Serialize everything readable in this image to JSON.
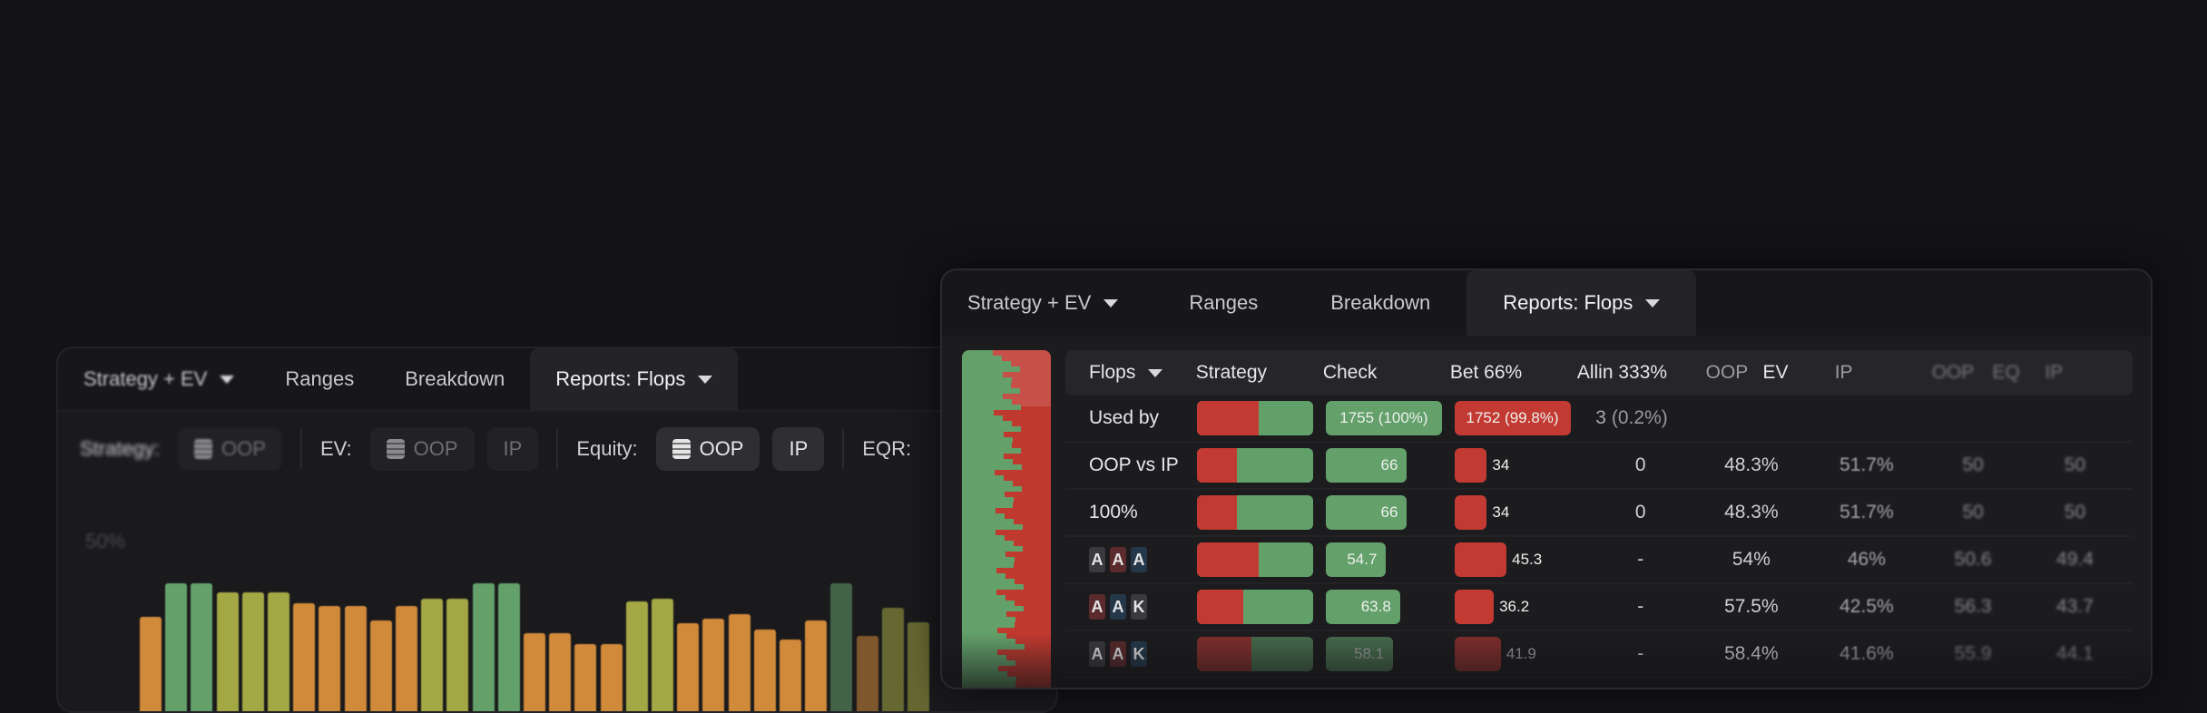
{
  "back_window": {
    "tabs": [
      {
        "label": "Strategy + EV",
        "active": false
      },
      {
        "label": "Ranges",
        "active": false
      },
      {
        "label": "Breakdown",
        "active": false
      },
      {
        "label": "Reports: Flops",
        "active": true
      }
    ],
    "toolbar": {
      "strategy_label": "Strategy:",
      "strategy_oop": "OOP",
      "ev_label": "EV:",
      "ev_oop": "OOP",
      "ev_ip": "IP",
      "equity_label": "Equity:",
      "equity_oop": "OOP",
      "equity_ip": "IP",
      "eqr_label": "EQR:"
    },
    "y_axis_label": "50%",
    "bar_heights": [
      0.66,
      0.88,
      0.88,
      0.82,
      0.82,
      0.82,
      0.75,
      0.73,
      0.73,
      0.64,
      0.73,
      0.78,
      0.78,
      0.88,
      0.88,
      0.56,
      0.56,
      0.49,
      0.49,
      0.76,
      0.78,
      0.62,
      0.65,
      0.68,
      0.58,
      0.52,
      0.64,
      0.88,
      0.54,
      0.72,
      0.63
    ],
    "bar_colors": [
      "#d08a3a",
      "#63a06a",
      "#63a06a",
      "#a4a844",
      "#a4a844",
      "#a4a844",
      "#d08a3a",
      "#d08a3a",
      "#d08a3a",
      "#d08a3a",
      "#d08a3a",
      "#a4a844",
      "#a4a844",
      "#63a06a",
      "#63a06a",
      "#d08a3a",
      "#d08a3a",
      "#d08a3a",
      "#d08a3a",
      "#a4a844",
      "#a4a844",
      "#d08a3a",
      "#d08a3a",
      "#d08a3a",
      "#d08a3a",
      "#d08a3a",
      "#d08a3a",
      "#63a06a",
      "#d08a3a",
      "#a4a844",
      "#a4a844"
    ]
  },
  "front_window": {
    "tabs": [
      {
        "label": "Strategy + EV",
        "active": false
      },
      {
        "label": "Ranges",
        "active": false
      },
      {
        "label": "Breakdown",
        "active": false
      },
      {
        "label": "Reports: Flops",
        "active": true
      }
    ],
    "headers": {
      "flops": "Flops",
      "strategy": "Strategy",
      "check": "Check",
      "bet": "Bet 66%",
      "allin": "Allin 333%",
      "oop": "OOP",
      "ev": "EV",
      "ip": "IP",
      "oop2": "OOP",
      "eq": "EQ",
      "ip2": "IP"
    },
    "rows": [
      {
        "label": "Used by",
        "strat_red": 0.53,
        "check": "1755 (100%)",
        "check_fill": 1.0,
        "bet": "1752 (99.8%)",
        "bet_fill": 1.0,
        "allin": "3",
        "allin_pct": "(0.2%)",
        "oop_ev": "",
        "ip_ev": "",
        "oop_eq": "",
        "ip_eq": ""
      },
      {
        "label": "OOP vs IP",
        "strat_red": 0.34,
        "check": "66",
        "check_fill": 0.7,
        "bet": "34",
        "bet_fill": 0.28,
        "allin": "0",
        "allin_pct": "",
        "oop_ev": "48.3%",
        "ip_ev": "51.7%",
        "oop_eq": "50",
        "ip_eq": "50"
      },
      {
        "label": "100%",
        "strat_red": 0.34,
        "check": "66",
        "check_fill": 0.7,
        "bet": "34",
        "bet_fill": 0.28,
        "allin": "0",
        "allin_pct": "",
        "oop_ev": "48.3%",
        "ip_ev": "51.7%",
        "oop_eq": "50",
        "ip_eq": "50"
      },
      {
        "label": "",
        "cards": [
          {
            "r": "A",
            "s": "g"
          },
          {
            "r": "A",
            "s": "r"
          },
          {
            "r": "A",
            "s": "b"
          }
        ],
        "strat_red": 0.53,
        "check": "54.7",
        "check_fill": 0.52,
        "bet": "45.3",
        "bet_fill": 0.45,
        "allin": "-",
        "allin_pct": "",
        "oop_ev": "54%",
        "ip_ev": "46%",
        "oop_eq": "50.6",
        "ip_eq": "49.4"
      },
      {
        "label": "",
        "cards": [
          {
            "r": "A",
            "s": "r"
          },
          {
            "r": "A",
            "s": "b"
          },
          {
            "r": "K",
            "s": "g"
          }
        ],
        "strat_red": 0.4,
        "check": "63.8",
        "check_fill": 0.64,
        "bet": "36.2",
        "bet_fill": 0.34,
        "allin": "-",
        "allin_pct": "",
        "oop_ev": "57.5%",
        "ip_ev": "42.5%",
        "oop_eq": "56.3",
        "ip_eq": "43.7"
      },
      {
        "label": "",
        "cards": [
          {
            "r": "A",
            "s": "g"
          },
          {
            "r": "A",
            "s": "r"
          },
          {
            "r": "K",
            "s": "b"
          }
        ],
        "strat_red": 0.47,
        "check": "58.1",
        "check_fill": 0.58,
        "bet": "41.9",
        "bet_fill": 0.4,
        "allin": "-",
        "allin_pct": "",
        "oop_ev": "58.4%",
        "ip_ev": "41.6%",
        "oop_eq": "55.9",
        "ip_eq": "44.1"
      }
    ]
  }
}
